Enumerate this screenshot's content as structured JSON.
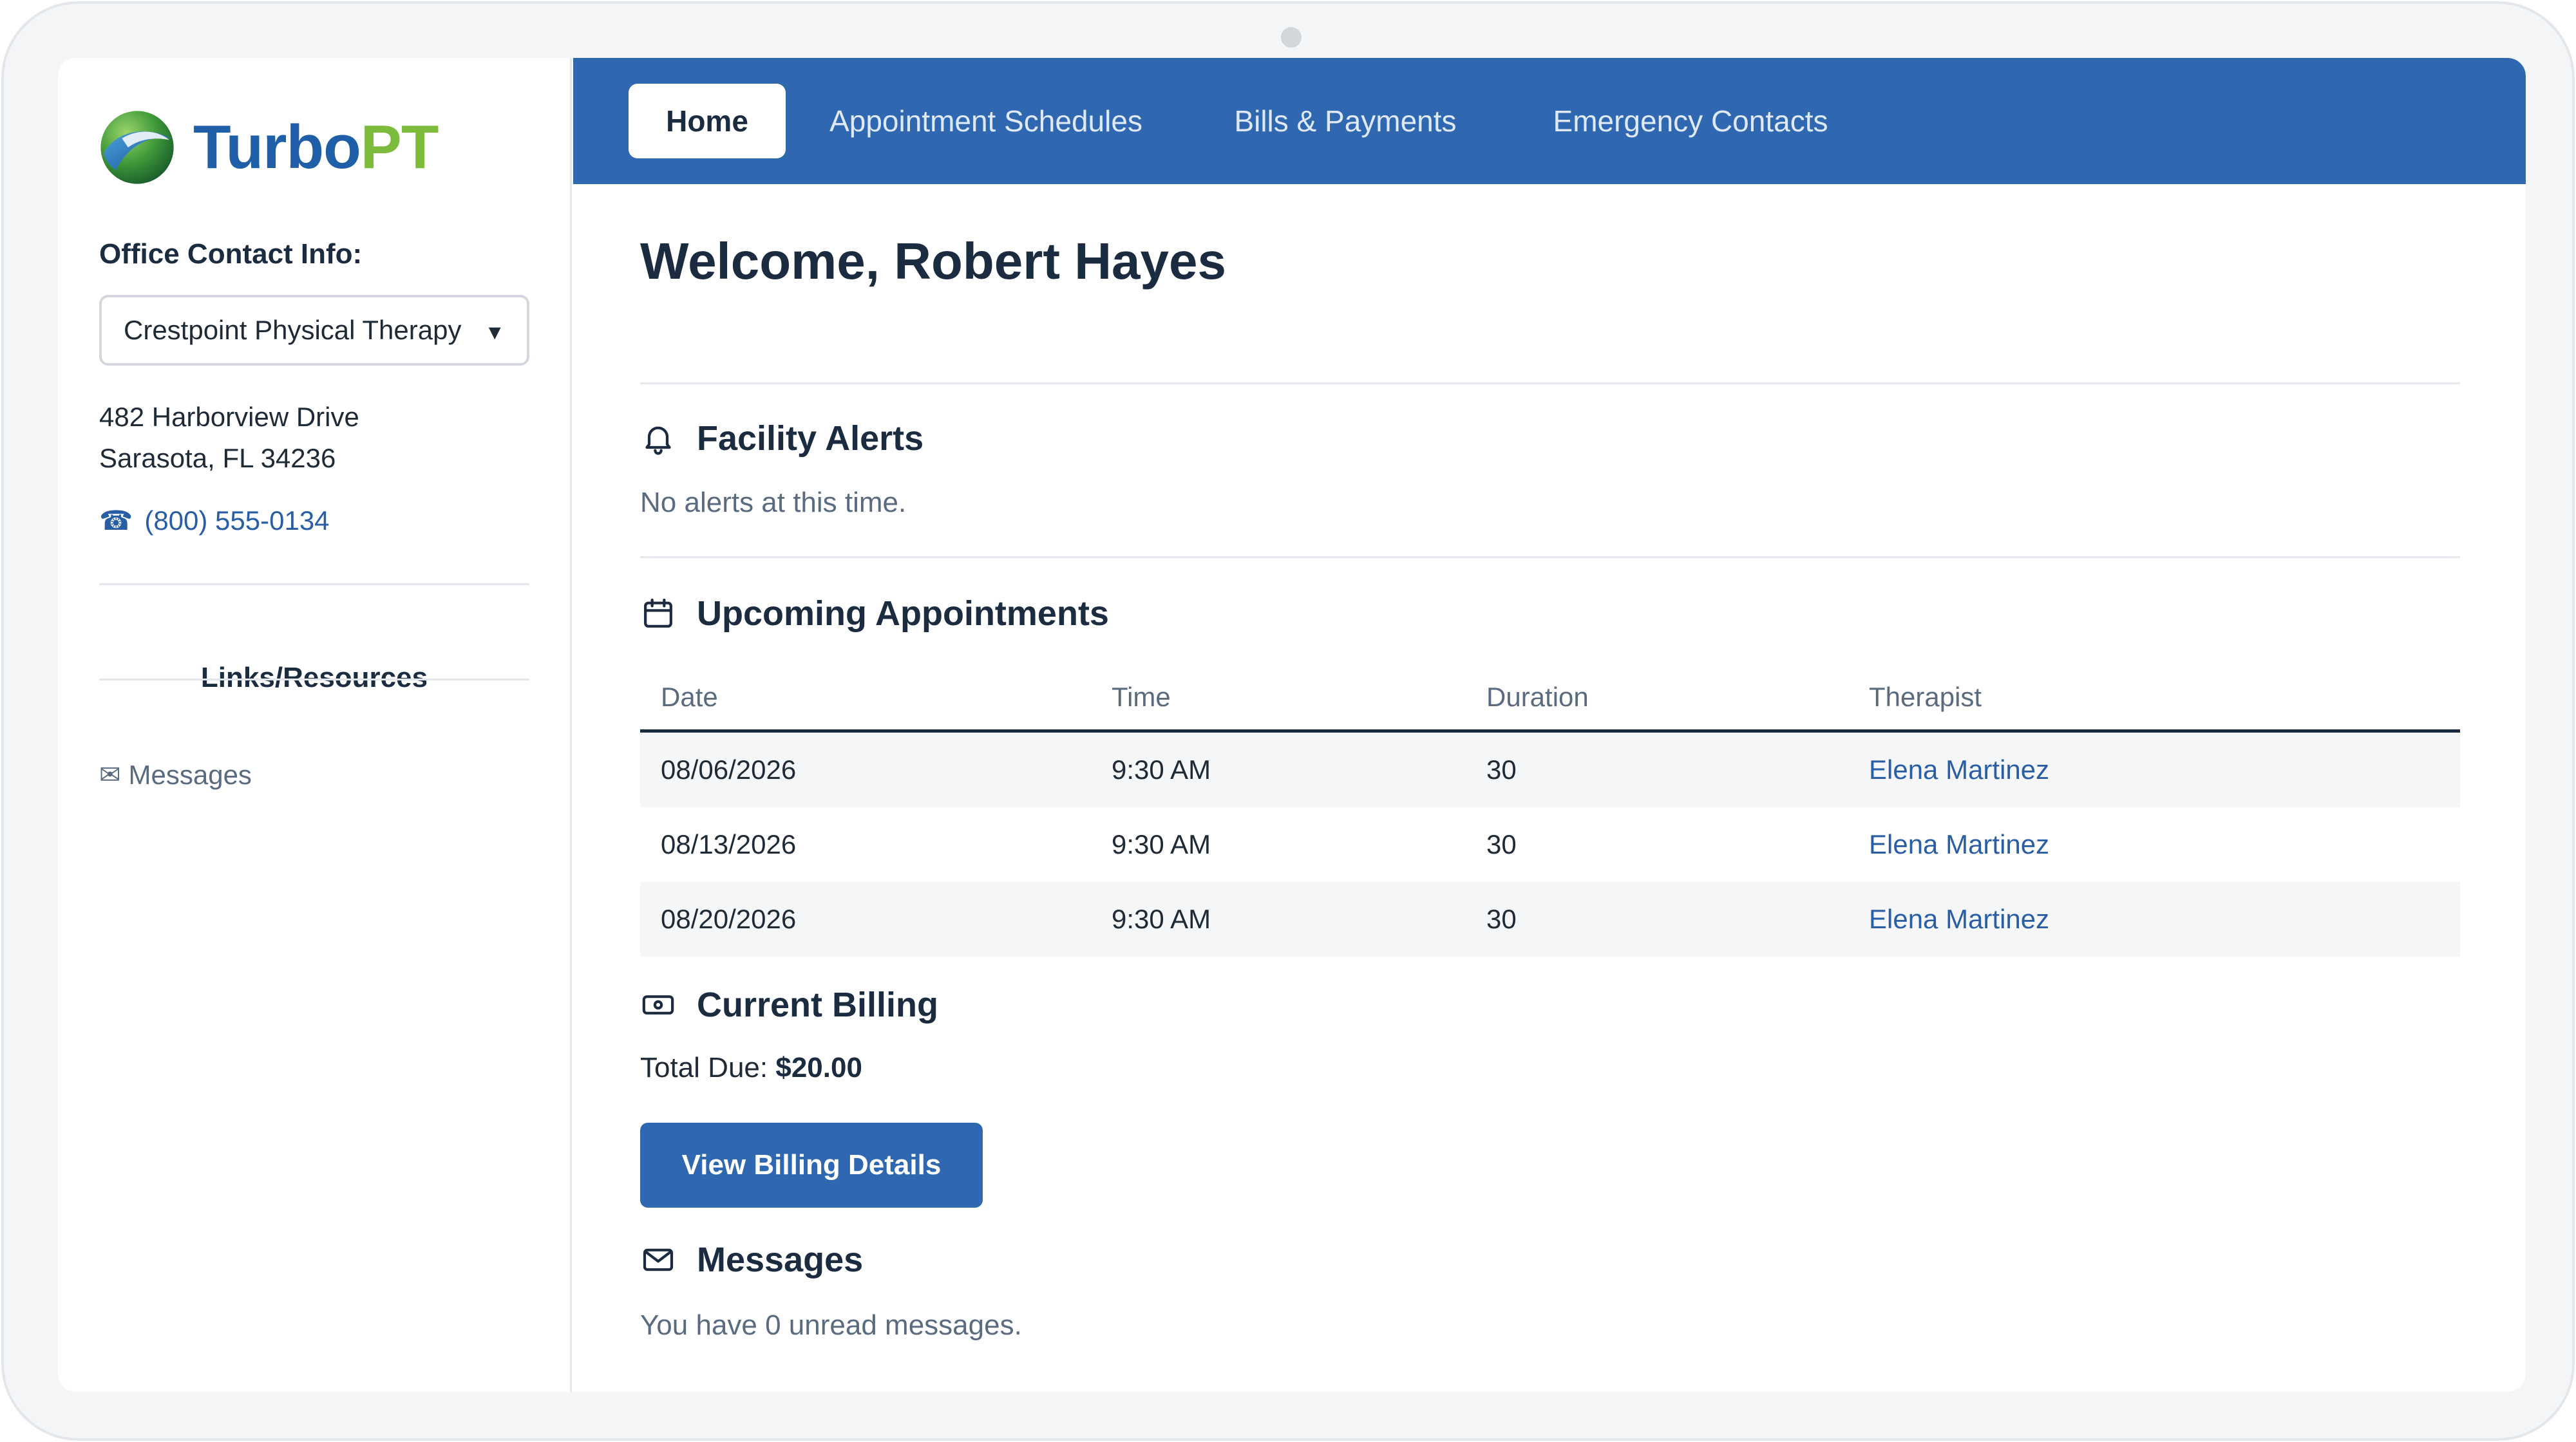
{
  "brand": {
    "name_part1": "Turbo",
    "name_part2": "PT",
    "primary": "#1f5fa8",
    "accent": "#7dbb3c"
  },
  "sidebar": {
    "office_label": "Office Contact Info:",
    "office_selected": "Crestpoint Physical Therapy",
    "address_line1": "482 Harborview Drive",
    "address_line2": "Sarasota, FL 34236",
    "phone": "(800) 555-0134",
    "links_title": "Links/Resources",
    "links": [
      {
        "label": "Messages",
        "icon": "envelope-icon"
      }
    ]
  },
  "nav": {
    "tabs": [
      {
        "label": "Home",
        "active": true
      },
      {
        "label": "Appointment Schedules",
        "active": false
      },
      {
        "label": "Bills & Payments",
        "active": false
      },
      {
        "label": "Emergency Contacts",
        "active": false
      }
    ],
    "color": "#2f68b0"
  },
  "main": {
    "welcome": "Welcome, Robert Hayes",
    "alerts": {
      "title": "Facility Alerts",
      "icon": "bell-icon",
      "text": "No alerts at this time."
    },
    "appointments": {
      "title": "Upcoming Appointments",
      "icon": "calendar-icon",
      "columns": [
        "Date",
        "Time",
        "Duration",
        "Therapist"
      ],
      "rows": [
        [
          "08/06/2026",
          "9:30 AM",
          "30",
          "Elena Martinez"
        ],
        [
          "08/13/2026",
          "9:30 AM",
          "30",
          "Elena Martinez"
        ],
        [
          "08/20/2026",
          "9:30 AM",
          "30",
          "Elena Martinez"
        ]
      ]
    },
    "billing": {
      "title": "Current Billing",
      "icon": "money-icon",
      "total_label": "Total Due:",
      "total_value": "$20.00",
      "button": "View Billing Details"
    },
    "messages": {
      "title": "Messages",
      "icon": "envelope-icon",
      "text": "You have 0 unread messages."
    }
  }
}
